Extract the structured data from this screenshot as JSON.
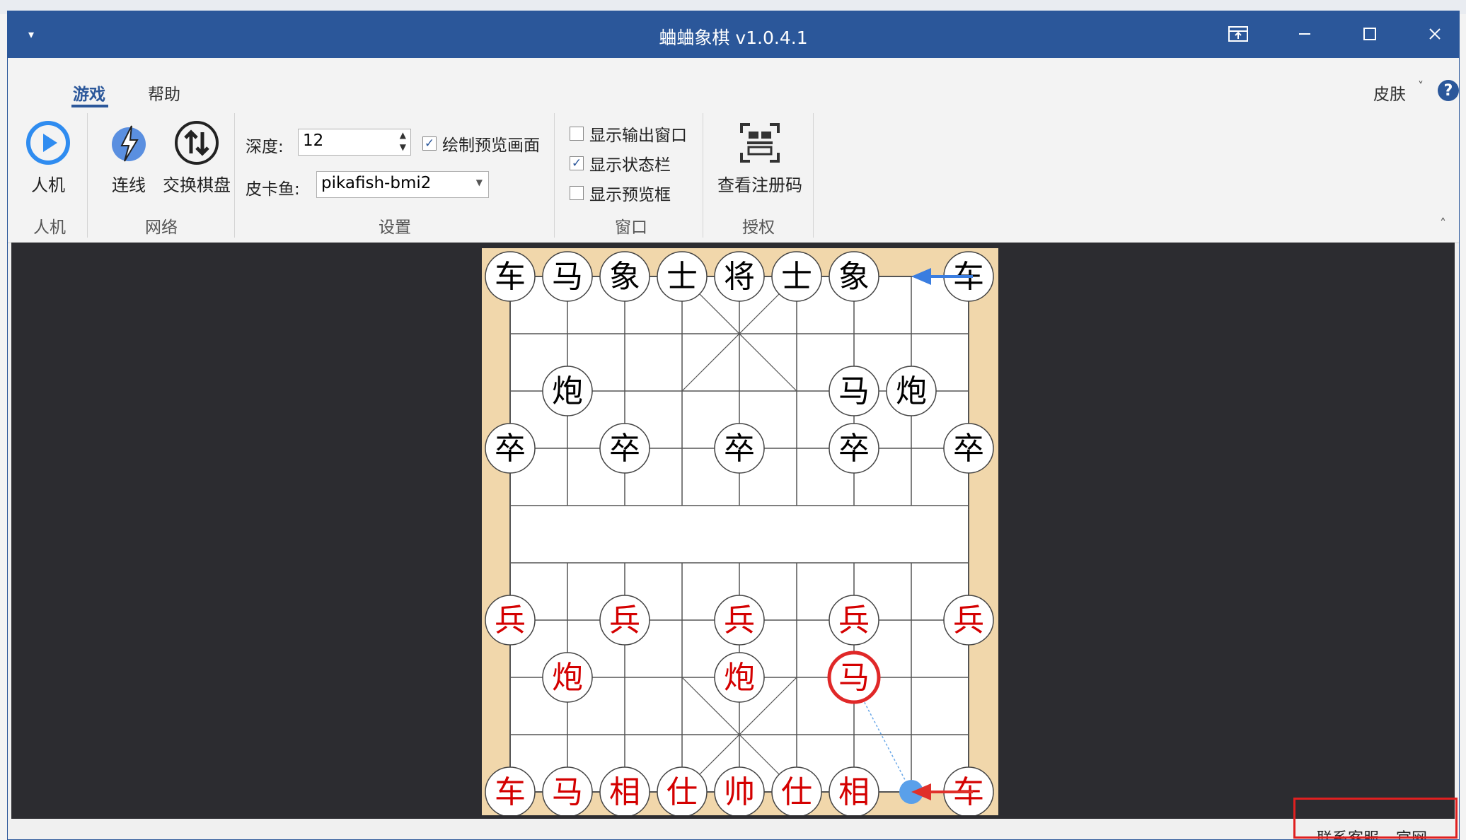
{
  "window": {
    "title": "蛐蛐象棋 v1.0.4.1"
  },
  "tabs": [
    {
      "label": "游戏",
      "active": true
    },
    {
      "label": "帮助",
      "active": false
    }
  ],
  "skin_label": "皮肤",
  "groups": {
    "human": "人机",
    "network": "网络",
    "settings": "设置",
    "window": "窗口",
    "license": "授权"
  },
  "buttons": {
    "human_machine": "人机",
    "connect": "连线",
    "swap_board": "交换棋盘",
    "view_code": "查看注册码"
  },
  "settings": {
    "depth_label": "深度:",
    "depth_value": "12",
    "engine_label": "皮卡鱼:",
    "engine_value": "pikafish-bmi2",
    "draw_preview": "绘制预览画面"
  },
  "window_options": {
    "show_output": "显示输出窗口",
    "show_status": "显示状态栏",
    "show_preview": "显示预览框"
  },
  "board": {
    "black_pieces": [
      {
        "c": "车",
        "f": 0,
        "r": 0
      },
      {
        "c": "马",
        "f": 1,
        "r": 0
      },
      {
        "c": "象",
        "f": 2,
        "r": 0
      },
      {
        "c": "士",
        "f": 3,
        "r": 0
      },
      {
        "c": "将",
        "f": 4,
        "r": 0
      },
      {
        "c": "士",
        "f": 5,
        "r": 0
      },
      {
        "c": "象",
        "f": 6,
        "r": 0
      },
      {
        "c": "车",
        "f": 8,
        "r": 0
      },
      {
        "c": "炮",
        "f": 1,
        "r": 2
      },
      {
        "c": "马",
        "f": 6,
        "r": 2
      },
      {
        "c": "炮",
        "f": 7,
        "r": 2
      },
      {
        "c": "卒",
        "f": 0,
        "r": 3
      },
      {
        "c": "卒",
        "f": 2,
        "r": 3
      },
      {
        "c": "卒",
        "f": 4,
        "r": 3
      },
      {
        "c": "卒",
        "f": 6,
        "r": 3
      },
      {
        "c": "卒",
        "f": 8,
        "r": 3
      }
    ],
    "red_pieces": [
      {
        "c": "兵",
        "f": 0,
        "r": 6
      },
      {
        "c": "兵",
        "f": 2,
        "r": 6
      },
      {
        "c": "兵",
        "f": 4,
        "r": 6
      },
      {
        "c": "兵",
        "f": 6,
        "r": 6
      },
      {
        "c": "兵",
        "f": 8,
        "r": 6
      },
      {
        "c": "炮",
        "f": 1,
        "r": 7
      },
      {
        "c": "炮",
        "f": 4,
        "r": 7
      },
      {
        "c": "马",
        "f": 6,
        "r": 7,
        "selected": true
      },
      {
        "c": "车",
        "f": 0,
        "r": 9
      },
      {
        "c": "马",
        "f": 1,
        "r": 9
      },
      {
        "c": "相",
        "f": 2,
        "r": 9
      },
      {
        "c": "仕",
        "f": 3,
        "r": 9
      },
      {
        "c": "帅",
        "f": 4,
        "r": 9
      },
      {
        "c": "仕",
        "f": 5,
        "r": 9
      },
      {
        "c": "相",
        "f": 6,
        "r": 9
      },
      {
        "c": "车",
        "f": 8,
        "r": 9
      }
    ],
    "arrows": [
      {
        "from": [
          8,
          0
        ],
        "to": [
          7,
          0
        ],
        "color": "#3a7de0"
      },
      {
        "from": [
          8,
          9
        ],
        "to": [
          7,
          9
        ],
        "color": "#e0302a"
      }
    ],
    "hint_dot": {
      "f": 7,
      "r": 9,
      "color": "#5aa0ea"
    }
  },
  "status": {
    "contact": "联系客服",
    "site": "官网"
  },
  "colors": {
    "accent": "#2b579a",
    "black_piece": "#000000",
    "red_piece": "#d40000",
    "board_bg": "#f1d7ab"
  }
}
